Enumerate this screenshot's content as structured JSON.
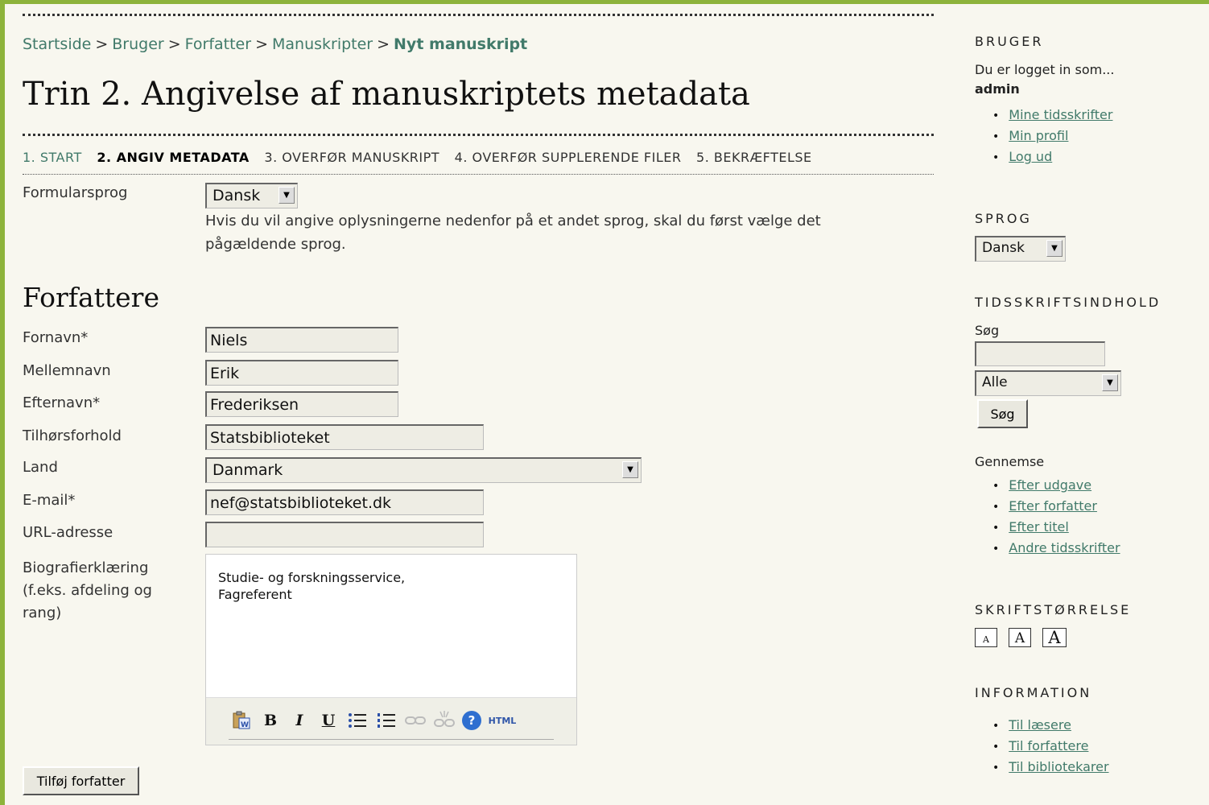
{
  "breadcrumb": {
    "items": [
      "Startside",
      "Bruger",
      "Forfatter",
      "Manuskripter"
    ],
    "current": "Nyt manuskript",
    "separator": ">"
  },
  "page_title": "Trin 2. Angivelse af manuskriptets metadata",
  "steps": [
    {
      "label": "1. START",
      "state": "done"
    },
    {
      "label": "2. ANGIV METADATA",
      "state": "active"
    },
    {
      "label": "3. OVERFØR MANUSKRIPT",
      "state": "todo"
    },
    {
      "label": "4. OVERFØR SUPPLERENDE FILER",
      "state": "todo"
    },
    {
      "label": "5. BEKRÆFTELSE",
      "state": "todo"
    }
  ],
  "form_language": {
    "label": "Formularsprog",
    "value": "Dansk",
    "hint": "Hvis du vil angive oplysningerne nedenfor på et andet sprog, skal du først vælge det pågældende sprog."
  },
  "authors": {
    "heading": "Forfattere",
    "fields": {
      "firstname": {
        "label": "Fornavn*",
        "value": "Niels"
      },
      "middlename": {
        "label": "Mellemnavn",
        "value": "Erik"
      },
      "lastname": {
        "label": "Efternavn*",
        "value": "Frederiksen"
      },
      "affiliation": {
        "label": "Tilhørsforhold",
        "value": "Statsbiblioteket"
      },
      "country": {
        "label": "Land",
        "value": "Danmark"
      },
      "email": {
        "label": "E-mail*",
        "value": "nef@statsbiblioteket.dk"
      },
      "url": {
        "label": "URL-adresse",
        "value": ""
      },
      "bio": {
        "label_lines": [
          "Biografierklæring",
          "(f.eks. afdeling og",
          "rang)"
        ],
        "value": "Studie- og forskningsservice,\nFagreferent"
      }
    },
    "editor_toolbar": [
      "paste-word-icon",
      "bold-icon",
      "italic-icon",
      "underline-icon",
      "bullet-list-icon",
      "numbered-list-icon",
      "link-icon",
      "unlink-icon",
      "help-icon",
      "html-source-icon"
    ],
    "toolbar_glyphs": {
      "bold": "B",
      "italic": "I",
      "underline": "U",
      "help": "?",
      "html": "HTML"
    },
    "add_author_button": "Tilføj forfatter"
  },
  "sidebar": {
    "user": {
      "heading": "BRUGER",
      "logged_in_text": "Du er logget in som...",
      "username": "admin",
      "links": [
        "Mine tidsskrifter",
        "Min profil",
        "Log ud"
      ]
    },
    "language": {
      "heading": "SPROG",
      "value": "Dansk"
    },
    "journal_content": {
      "heading": "TIDSSKRIFTSINDHOLD",
      "search_label": "Søg",
      "search_value": "",
      "scope_value": "Alle",
      "search_button": "Søg",
      "browse_label": "Gennemse",
      "browse_links": [
        "Efter udgave",
        "Efter forfatter",
        "Efter titel",
        "Andre tidsskrifter"
      ]
    },
    "font_size": {
      "heading": "SKRIFTSTØRRELSE",
      "glyph": "A"
    },
    "information": {
      "heading": "INFORMATION",
      "links": [
        "Til læsere",
        "Til forfattere",
        "Til bibliotekarer"
      ]
    }
  },
  "colors": {
    "frame": "#8db33b",
    "link": "#417a6a",
    "background": "#f8f7ef"
  }
}
